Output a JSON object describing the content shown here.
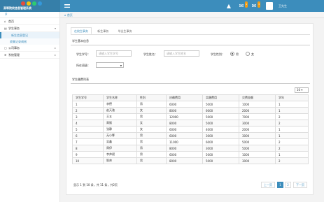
{
  "app": {
    "title": "高等院校信息管理系统",
    "user_name": "王先生",
    "notification_count": "4",
    "message_count": "3"
  },
  "sidebar": {
    "items": [
      {
        "label": "首页",
        "icon": "home-icon"
      },
      {
        "label": "学生事务",
        "icon": "folder-icon",
        "expanded": true,
        "children": [
          {
            "label": "新生信息登记",
            "active": true
          },
          {
            "label": "收集记录调阅",
            "active": false
          }
        ]
      },
      {
        "label": "公司事务",
        "icon": "file-icon",
        "expanded": false
      },
      {
        "label": "系统管理",
        "icon": "gear-icon",
        "expanded": false
      }
    ]
  },
  "breadcrumb": {
    "label": "首页"
  },
  "tabs": [
    {
      "label": "在校生事务",
      "active": true
    },
    {
      "label": "新生事务",
      "active": false
    },
    {
      "label": "毕业生事务",
      "active": false
    }
  ],
  "form": {
    "section_title": "学生基本信息",
    "student_id_label": "学生学号：",
    "student_id_placeholder": "请输入学生学号",
    "student_name_label": "学生姓名：",
    "student_name_placeholder": "请输入学生姓名",
    "gender_label": "学生性别：",
    "gender_male": "男",
    "gender_female": "女",
    "gender_selected": "男",
    "class_label": "所在班级：",
    "class_value": ""
  },
  "list": {
    "section_title": "学生缴费列表",
    "page_size": "10",
    "columns": [
      "学生学号",
      "学生名称",
      "性别",
      "应缴费用",
      "实缴费用",
      "欠费金额",
      "学年"
    ],
    "rows": [
      [
        "1",
        "李德",
        "男",
        "6000",
        "5000",
        "1000",
        "1"
      ],
      [
        "2",
        "赵天驰",
        "女",
        "8000",
        "6000",
        "2000",
        "1"
      ],
      [
        "3",
        "王五",
        "男",
        "12000",
        "5000",
        "7000",
        "2"
      ],
      [
        "4",
        "高猴",
        "女",
        "8000",
        "5000",
        "3000",
        "2"
      ],
      [
        "5",
        "张静",
        "女",
        "6000",
        "4000",
        "2000",
        "1"
      ],
      [
        "6",
        "无小筹",
        "男",
        "6000",
        "3000",
        "3000",
        "1"
      ],
      [
        "7",
        "吴鑫",
        "男",
        "11000",
        "6000",
        "5000",
        "2"
      ],
      [
        "8",
        "周伊",
        "男",
        "8000",
        "3000",
        "5000",
        "2"
      ],
      [
        "9",
        "李帅斌",
        "男",
        "6000",
        "5000",
        "1000",
        "1"
      ],
      [
        "10",
        "智帅",
        "男",
        "8000",
        "5000",
        "3000",
        "2"
      ]
    ],
    "pager_info": "显示 1 到 10 条，共 11 条，共2页",
    "prev_label": "上一页",
    "next_label": "下一页",
    "pages": [
      "1",
      "2"
    ],
    "current_page": "1"
  }
}
